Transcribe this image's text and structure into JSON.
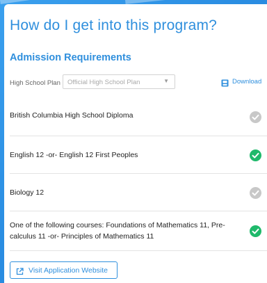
{
  "page": {
    "title": "How do I get into this program?"
  },
  "admission": {
    "section_title": "Admission Requirements",
    "plan_label": "High School Plan",
    "plan_select_value": "Official High School Plan",
    "download_label": "Download",
    "requirements": [
      {
        "text": "British Columbia High School Diploma",
        "status": "incomplete"
      },
      {
        "text": "English 12 -or- English 12 First Peoples",
        "status": "complete"
      },
      {
        "text": "Biology 12",
        "status": "incomplete"
      },
      {
        "text": "One of the following courses: Foundations of Mathematics 11, Pre-calculus 11 -or- Principles of Mathematics 11",
        "status": "complete"
      }
    ],
    "visit_button_label": "Visit Application Website"
  },
  "colors": {
    "accent": "#2f8fdd",
    "complete": "#1fb96b",
    "incomplete": "#c8c8c8",
    "background": "#2d8fe0"
  },
  "icons": {
    "download": "download-icon",
    "complete": "check-circle-icon",
    "incomplete": "check-circle-gray-icon",
    "external_link": "external-link-icon",
    "select_caret": "chevron-down-icon"
  }
}
